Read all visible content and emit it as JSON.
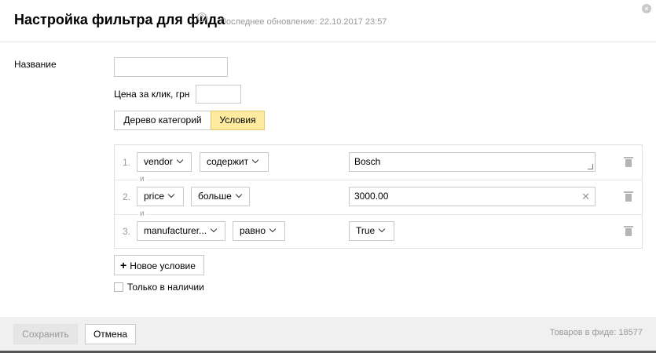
{
  "header": {
    "title": "Настройка фильтра для фида",
    "help_glyph": "?",
    "updated": "Последнее обновление: 22.10.2017 23:57",
    "close_glyph": "×"
  },
  "form": {
    "name_label": "Название",
    "name_value": "",
    "price_label": "Цена за клик, грн",
    "price_value": ""
  },
  "tabs": {
    "tree": "Дерево категорий",
    "conditions": "Условия"
  },
  "conditions": {
    "and_label": "и",
    "rows": [
      {
        "num": "1.",
        "field": "vendor",
        "op": "содержит",
        "value": "Bosch"
      },
      {
        "num": "2.",
        "field": "price",
        "op": "больше",
        "value": "3000.00"
      },
      {
        "num": "3.",
        "field": "manufacturer...",
        "op": "равно",
        "value": "True"
      }
    ]
  },
  "actions": {
    "add_condition": "Новое условие",
    "in_stock": "Только в наличии"
  },
  "footer": {
    "save": "Сохранить",
    "cancel": "Отмена",
    "count": "Товаров в фиде: 18577"
  },
  "colors": {
    "active_tab": "#ffeba0",
    "border": "#c9c9c9",
    "muted_text": "#999999",
    "footer_bg": "#f0f0f0"
  }
}
